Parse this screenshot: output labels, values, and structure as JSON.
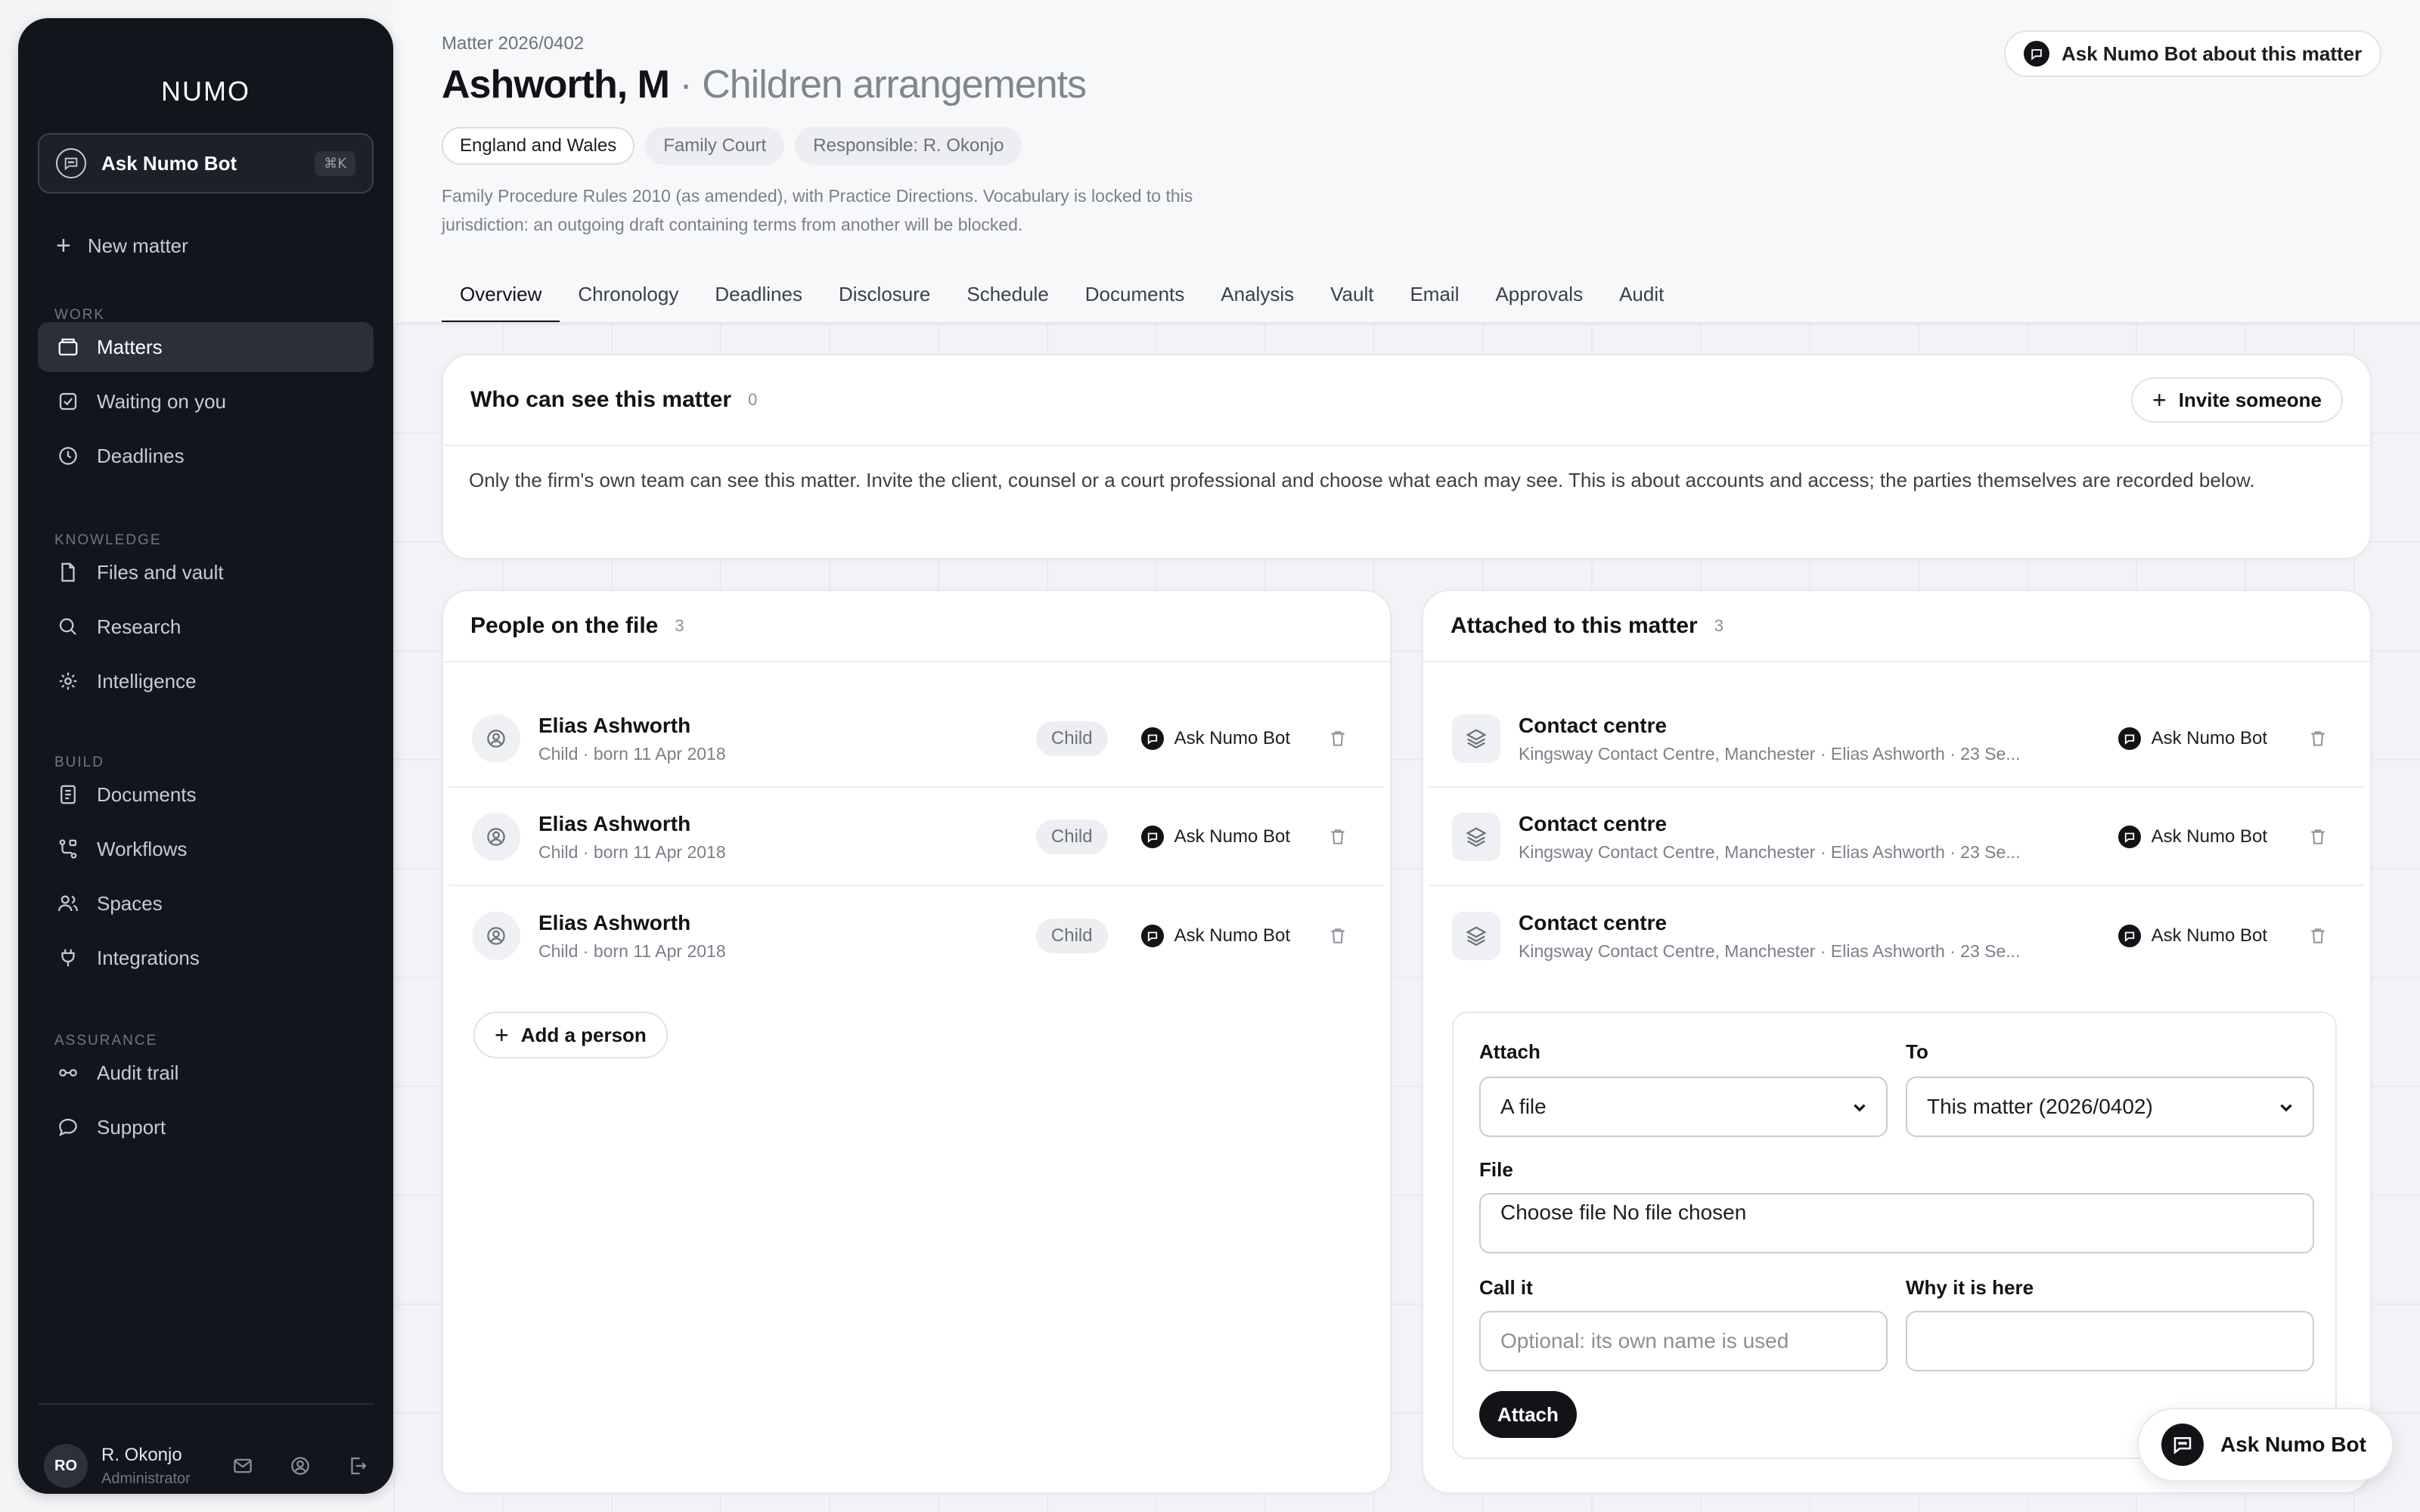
{
  "sidebar": {
    "logo": "NUMO",
    "ask_bot": {
      "label": "Ask Numo Bot",
      "shortcut": "⌘K"
    },
    "new_matter": "New matter",
    "sections": {
      "work": "WORK",
      "knowledge": "KNOWLEDGE",
      "build": "BUILD",
      "assurance": "ASSURANCE"
    },
    "items": {
      "matters": "Matters",
      "waiting": "Waiting on you",
      "deadlines": "Deadlines",
      "files": "Files and vault",
      "research": "Research",
      "intelligence": "Intelligence",
      "documents": "Documents",
      "workflows": "Workflows",
      "spaces": "Spaces",
      "integrations": "Integrations",
      "audit": "Audit trail",
      "support": "Support"
    },
    "user": {
      "initials": "RO",
      "name": "R. Okonjo",
      "role": "Administrator"
    }
  },
  "header": {
    "matter_number": "Matter 2026/0402",
    "title": "Ashworth, M",
    "subtitle": " · Children arrangements",
    "chips": [
      "England and Wales",
      "Family Court",
      "Responsible: R. Okonjo"
    ],
    "description": "Family Procedure Rules 2010 (as amended), with Practice Directions. Vocabulary is locked to this jurisdiction: an outgoing draft containing terms from another will be blocked.",
    "ask_button": "Ask Numo Bot about this matter"
  },
  "tabs": [
    "Overview",
    "Chronology",
    "Deadlines",
    "Disclosure",
    "Schedule",
    "Documents",
    "Analysis",
    "Vault",
    "Email",
    "Approvals",
    "Audit"
  ],
  "visibility": {
    "title": "Who can see this matter",
    "count": "0",
    "invite": "Invite someone",
    "text": "Only the firm's own team can see this matter. Invite the client, counsel or a court professional and choose what each may see. This is about accounts and access; the parties themselves are recorded below."
  },
  "people": {
    "title": "People on the file",
    "count": "3",
    "rows": [
      {
        "name": "Elias Ashworth",
        "sub": "Child · born 11 Apr 2018",
        "badge": "Child",
        "bot": "Ask Numo Bot"
      },
      {
        "name": "Elias Ashworth",
        "sub": "Child · born 11 Apr 2018",
        "badge": "Child",
        "bot": "Ask Numo Bot"
      },
      {
        "name": "Elias Ashworth",
        "sub": "Child · born 11 Apr 2018",
        "badge": "Child",
        "bot": "Ask Numo Bot"
      }
    ],
    "add": "Add a person"
  },
  "attached": {
    "title": "Attached to this matter",
    "count": "3",
    "rows": [
      {
        "name": "Contact centre",
        "sub": "Kingsway Contact Centre, Manchester · Elias Ashworth · 23 Se...",
        "bot": "Ask Numo Bot"
      },
      {
        "name": "Contact centre",
        "sub": "Kingsway Contact Centre, Manchester · Elias Ashworth · 23 Se...",
        "bot": "Ask Numo Bot"
      },
      {
        "name": "Contact centre",
        "sub": "Kingsway Contact Centre, Manchester · Elias Ashworth · 23 Se...",
        "bot": "Ask Numo Bot"
      }
    ],
    "form": {
      "attach_label": "Attach",
      "attach_value": "A file",
      "to_label": "To",
      "to_value": "This matter (2026/0402)",
      "file_label": "File",
      "file_value": "Choose file No file chosen",
      "call_label": "Call it",
      "call_placeholder": "Optional: its own name is used",
      "why_label": "Why it is here",
      "why_value": "",
      "submit": "Attach"
    }
  },
  "fab": "Ask Numo Bot",
  "colors": {
    "sidebar_bg": "#12151b",
    "accent_dark": "#111317",
    "page_bg": "#f4f5f7"
  }
}
